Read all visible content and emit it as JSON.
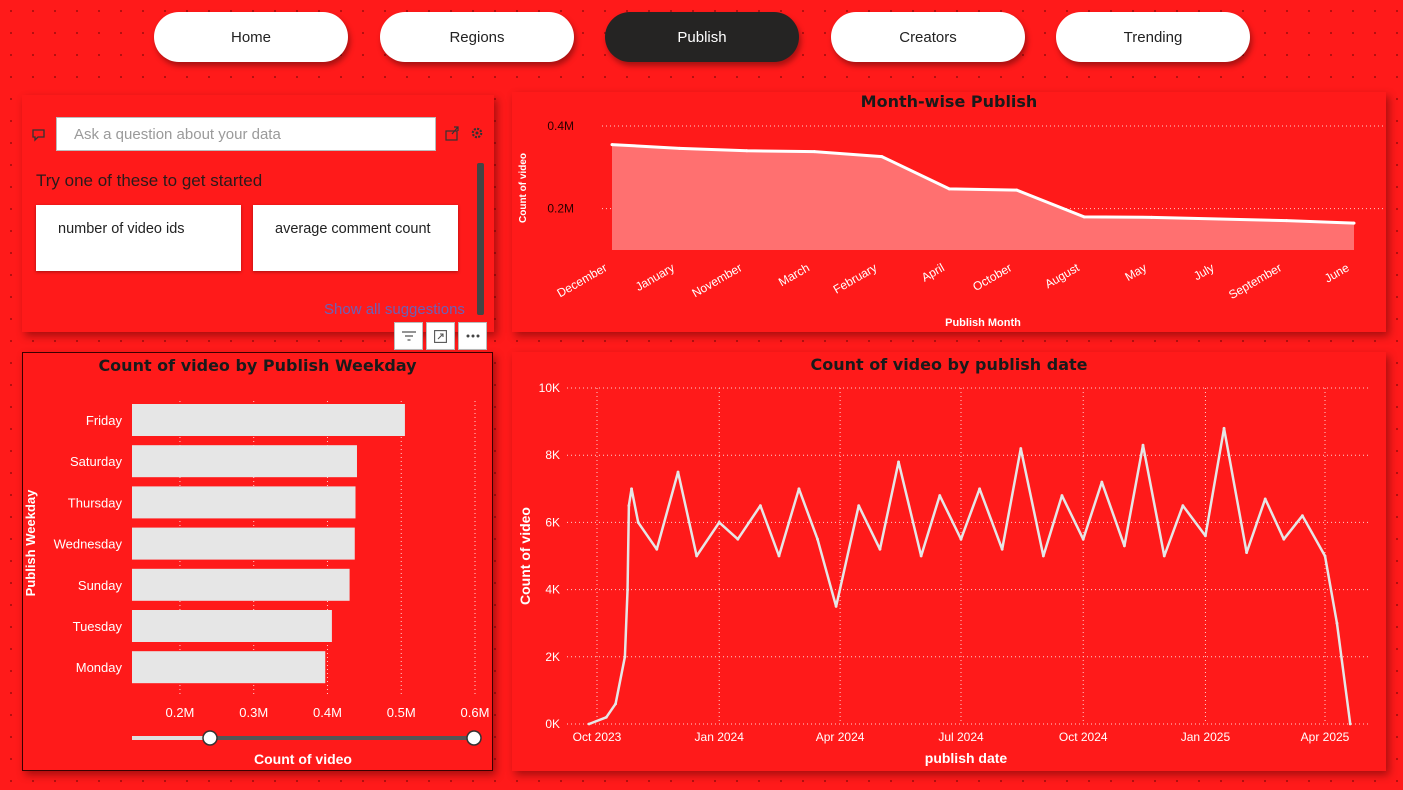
{
  "nav": {
    "home": "Home",
    "regions": "Regions",
    "publish": "Publish",
    "creators": "Creators",
    "trending": "Trending"
  },
  "qa": {
    "placeholder": "Ask a question about your data",
    "prompt": "Try one of these to get started",
    "suggestions": [
      "number of video ids",
      "average comment count"
    ],
    "show_all": "Show all suggestions"
  },
  "colors": {
    "background": "#ff1a1a",
    "nav_active": "#252423",
    "line": "#ffffff",
    "area_fill": "#ff7070",
    "bars": "#e6e6e6"
  },
  "chart_data": [
    {
      "type": "area",
      "title": "Month-wise Publish",
      "xlabel": "Publish Month",
      "ylabel": "Count of video",
      "categories": [
        "December",
        "January",
        "November",
        "March",
        "February",
        "April",
        "October",
        "August",
        "May",
        "July",
        "September",
        "June"
      ],
      "values": [
        355000,
        346000,
        340000,
        338000,
        326000,
        248000,
        245000,
        180000,
        179000,
        175000,
        171000,
        165000
      ],
      "yticks": [
        "0.2M",
        "0.4M"
      ],
      "ylim": [
        100000,
        400000
      ],
      "grid": true
    },
    {
      "type": "bar",
      "orientation": "horizontal",
      "title": "Count of video by Publish Weekday",
      "xlabel": "Count of video",
      "ylabel": "Publish Weekday",
      "categories": [
        "Friday",
        "Saturday",
        "Thursday",
        "Wednesday",
        "Sunday",
        "Tuesday",
        "Monday"
      ],
      "values": [
        505000,
        440000,
        438000,
        437000,
        430000,
        406000,
        397000
      ],
      "xticks": [
        "0.2M",
        "0.3M",
        "0.4M",
        "0.5M",
        "0.6M"
      ],
      "xlim": [
        135000,
        600000
      ],
      "grid": true
    },
    {
      "type": "line",
      "title": "Count of video by publish date",
      "xlabel": "publish date",
      "ylabel": "Count of video",
      "xticks": [
        "Oct 2023",
        "Jan 2024",
        "Apr 2024",
        "Jul 2024",
        "Oct 2024",
        "Jan 2025",
        "Apr 2025"
      ],
      "yticks": [
        "0K",
        "2K",
        "4K",
        "6K",
        "8K",
        "10K"
      ],
      "ylim": [
        0,
        10000
      ],
      "grid": true,
      "x": [
        "2023-09-25",
        "2023-10-08",
        "2023-10-15",
        "2023-10-22",
        "2023-10-24",
        "2023-10-25",
        "2023-10-27",
        "2023-11-01",
        "2023-11-15",
        "2023-12-01",
        "2023-12-15",
        "2024-01-01",
        "2024-01-15",
        "2024-02-01",
        "2024-02-15",
        "2024-03-01",
        "2024-03-15",
        "2024-03-29",
        "2024-04-15",
        "2024-05-01",
        "2024-05-15",
        "2024-06-01",
        "2024-06-15",
        "2024-07-01",
        "2024-07-15",
        "2024-08-01",
        "2024-08-15",
        "2024-09-01",
        "2024-09-15",
        "2024-10-01",
        "2024-10-15",
        "2024-11-01",
        "2024-11-15",
        "2024-12-01",
        "2024-12-15",
        "2025-01-01",
        "2025-01-15",
        "2025-02-01",
        "2025-02-15",
        "2025-03-01",
        "2025-03-15",
        "2025-04-01",
        "2025-04-10",
        "2025-04-20"
      ],
      "values": [
        0,
        200,
        600,
        2000,
        4000,
        6500,
        7000,
        6000,
        5200,
        7500,
        5000,
        6000,
        5500,
        6500,
        5000,
        7000,
        5500,
        3500,
        6500,
        5200,
        7800,
        5000,
        6800,
        5500,
        7000,
        5200,
        8200,
        5000,
        6800,
        5500,
        7200,
        5300,
        8300,
        5000,
        6500,
        5600,
        8800,
        5100,
        6700,
        5500,
        6200,
        5000,
        3000,
        0
      ]
    }
  ]
}
